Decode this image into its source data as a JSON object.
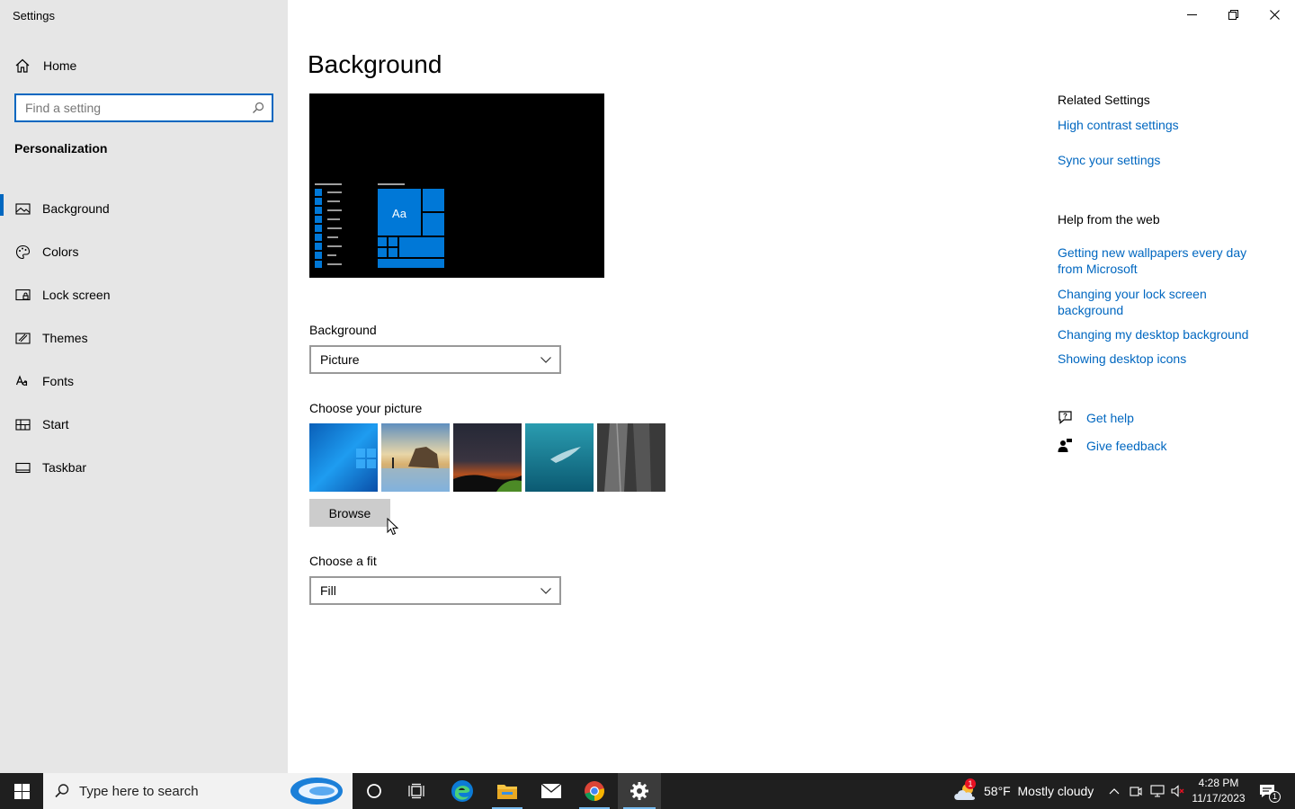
{
  "app": {
    "title": "Settings"
  },
  "sidebar": {
    "home_label": "Home",
    "search_placeholder": "Find a setting",
    "section_title": "Personalization",
    "items": [
      {
        "label": "Background",
        "icon": "picture-icon",
        "active": true
      },
      {
        "label": "Colors",
        "icon": "palette-icon",
        "active": false
      },
      {
        "label": "Lock screen",
        "icon": "lock-screen-icon",
        "active": false
      },
      {
        "label": "Themes",
        "icon": "themes-icon",
        "active": false
      },
      {
        "label": "Fonts",
        "icon": "fonts-icon",
        "active": false
      },
      {
        "label": "Start",
        "icon": "start-tiles-icon",
        "active": false
      },
      {
        "label": "Taskbar",
        "icon": "taskbar-icon",
        "active": false
      }
    ]
  },
  "main": {
    "title": "Background",
    "preview_tile_label": "Aa",
    "background_label": "Background",
    "background_value": "Picture",
    "choose_picture_label": "Choose your picture",
    "browse_label": "Browse",
    "fit_label": "Choose a fit",
    "fit_value": "Fill"
  },
  "related": {
    "heading": "Related Settings",
    "links": [
      "High contrast settings",
      "Sync your settings"
    ]
  },
  "help": {
    "heading": "Help from the web",
    "links": [
      "Getting new wallpapers every day from Microsoft",
      "Changing your lock screen background",
      "Changing my desktop background",
      "Showing desktop icons"
    ],
    "get_help": "Get help",
    "give_feedback": "Give feedback"
  },
  "taskbar": {
    "search_placeholder": "Type here to search",
    "weather_badge": "1",
    "weather": "58°F  Mostly cloudy",
    "time": "4:28 PM",
    "date": "11/17/2023",
    "notification_count": "1"
  },
  "colors": {
    "accent": "#0067c0",
    "sidebar_bg": "#e6e6e6",
    "taskbar_bg": "#1f1f1f"
  }
}
